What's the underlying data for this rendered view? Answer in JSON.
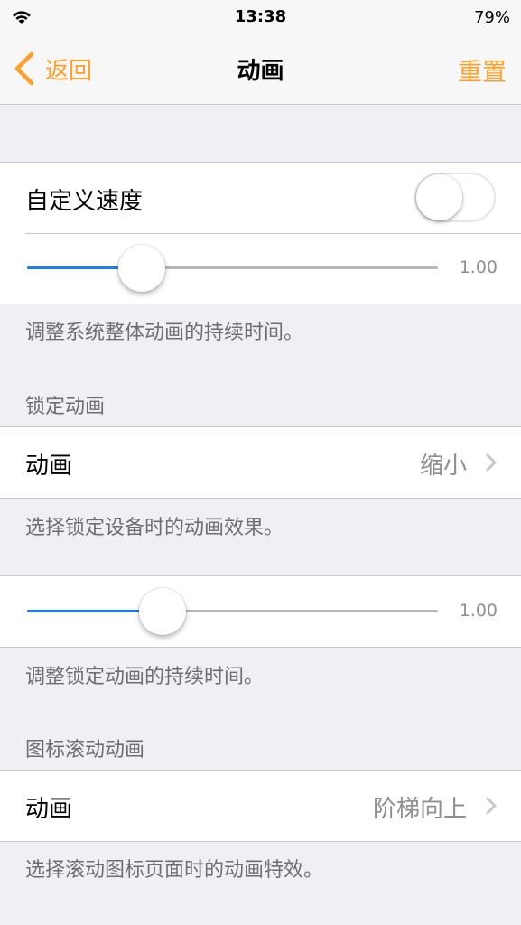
{
  "status_bar": {
    "time": "13:38",
    "battery": "79%"
  },
  "nav": {
    "back_label": "返回",
    "title": "动画",
    "reset_label": "重置"
  },
  "group1": {
    "custom_speed_label": "自定义速度",
    "custom_speed_enabled": false,
    "slider_value_text": "1.00",
    "slider_fraction": 0.28,
    "footer": "调整系统整体动画的持续时间。"
  },
  "lock_section": {
    "header": "锁定动画",
    "animation_label": "动画",
    "animation_value": "缩小",
    "footer": "选择锁定设备时的动画效果。"
  },
  "lock_duration": {
    "slider_value_text": "1.00",
    "slider_fraction": 0.33,
    "footer": "调整锁定动画的持续时间。"
  },
  "icon_scroll_section": {
    "header": "图标滚动动画",
    "animation_label": "动画",
    "animation_value": "阶梯向上",
    "footer": "选择滚动图标页面时的动画特效。"
  },
  "colors": {
    "accent": "#ff9f28",
    "slider_fill": "#1a7cf2"
  }
}
